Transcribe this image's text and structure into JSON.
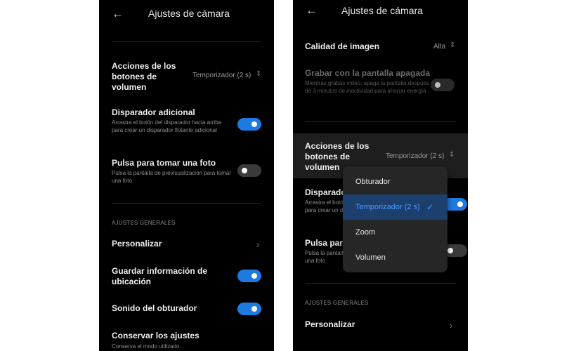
{
  "colors": {
    "accent": "#1f7ae0",
    "background": "#000000",
    "selected_bg": "#1d3f6e"
  },
  "left": {
    "back_icon": "arrow-left-icon",
    "title": "Ajustes de cámara",
    "volume_label": "Acciones de los botones de volumen",
    "volume_value": "Temporizador (2 s)",
    "extra_shutter_label": "Disparador adicional",
    "extra_shutter_desc": "Arrastra el botón del disparador hacia arriba para crear un disparador flotante adicional",
    "extra_shutter_on": true,
    "tap_photo_label": "Pulsa para tomar una foto",
    "tap_photo_desc": "Pulsa la pantalla de previsualización para tomar una foto",
    "tap_photo_on": false,
    "section_general": "AJUSTES GENERALES",
    "customize_label": "Personalizar",
    "location_label": "Guardar información de ubicación",
    "location_on": true,
    "shutter_sound_label": "Sonido del obturador",
    "shutter_sound_on": true,
    "keep_settings_label": "Conservar los ajustes",
    "keep_settings_desc": "Conserva el modo utilizado"
  },
  "right": {
    "back_icon": "arrow-left-icon",
    "title": "Ajustes de cámara",
    "quality_label": "Calidad de imagen",
    "quality_value": "Alta",
    "record_off_label": "Grabar con la pantalla apagada",
    "record_off_desc": "Mientras grabas vídeo, apaga la pantalla después de 3 minutos de inactividad para ahorrar energía",
    "record_off_on": false,
    "volume_label": "Acciones de los botones de volumen",
    "volume_value": "Temporizador (2 s)",
    "extra_shutter_label": "Disparador adicional",
    "extra_shutter_desc": "Arrastra el botón del disparador hacia arriba para crear un disparador flotante adicional",
    "tap_photo_label": "Pulsa para tomar una foto",
    "tap_photo_desc": "Pulsa la pantalla de previsualización para tomar una foto",
    "section_general": "AJUSTES GENERALES",
    "customize_label": "Personalizar",
    "menu": {
      "options": [
        "Obturador",
        "Temporizador (2 s)",
        "Zoom",
        "Volumen"
      ],
      "selected": "Temporizador (2 s)"
    }
  }
}
